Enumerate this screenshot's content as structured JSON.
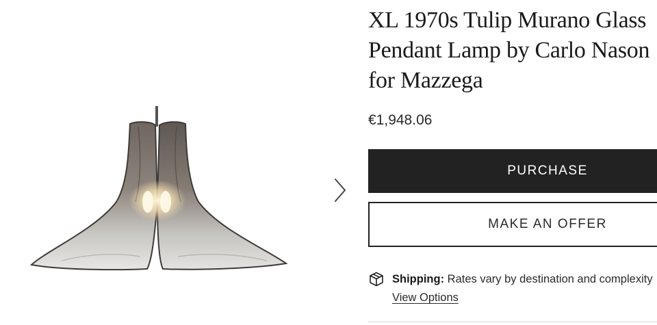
{
  "product": {
    "title": "XL 1970s Tulip Murano Glass Pendant Lamp by Carlo Nason for Mazzega",
    "price": "€1,948.06",
    "image_icon": "pendant-lamp-photo"
  },
  "gallery": {
    "next_icon": "chevron-right-icon"
  },
  "actions": {
    "purchase_label": "PURCHASE",
    "offer_label": "MAKE AN OFFER"
  },
  "shipping": {
    "icon": "package-icon",
    "label": "Shipping:",
    "text": "Rates vary by destination and complexity",
    "link": "View Options"
  },
  "colors": {
    "primary_button": "#222222",
    "text": "#1a1a1a"
  }
}
